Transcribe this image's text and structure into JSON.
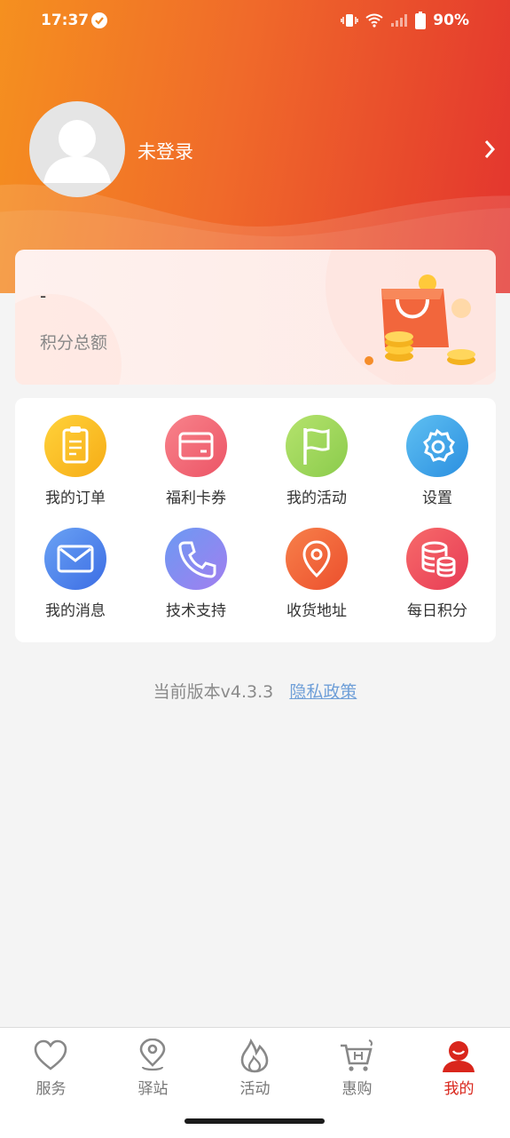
{
  "status_bar": {
    "time": "17:37",
    "battery": "90%"
  },
  "profile": {
    "login_status": "未登录"
  },
  "points": {
    "value": "-",
    "label": "积分总额"
  },
  "menu": {
    "items": [
      {
        "label": "我的订单",
        "icon": "order-icon",
        "color": "#f7b91b"
      },
      {
        "label": "福利卡券",
        "icon": "card-icon",
        "color": "#f06b77"
      },
      {
        "label": "我的活动",
        "icon": "flag-icon",
        "color": "#9fd65a"
      },
      {
        "label": "设置",
        "icon": "gear-icon",
        "color": "#3aa3ea"
      },
      {
        "label": "我的消息",
        "icon": "mail-icon",
        "color": "#4f84ec"
      },
      {
        "label": "技术支持",
        "icon": "phone-icon",
        "color": "#8b8cf0"
      },
      {
        "label": "收货地址",
        "icon": "location-icon",
        "color": "#f2683c"
      },
      {
        "label": "每日积分",
        "icon": "database-icon",
        "color": "#ef4c5a"
      }
    ]
  },
  "footer": {
    "version": "当前版本v4.3.3",
    "privacy": "隐私政策"
  },
  "tabs": [
    {
      "label": "服务",
      "icon": "heart-icon"
    },
    {
      "label": "驿站",
      "icon": "map-pin-icon"
    },
    {
      "label": "活动",
      "icon": "flame-icon"
    },
    {
      "label": "惠购",
      "icon": "cart-icon"
    },
    {
      "label": "我的",
      "icon": "user-icon",
      "active": true
    }
  ],
  "colors": {
    "accent": "#d9261c",
    "header_start": "#f5901f",
    "header_end": "#e3342e"
  }
}
